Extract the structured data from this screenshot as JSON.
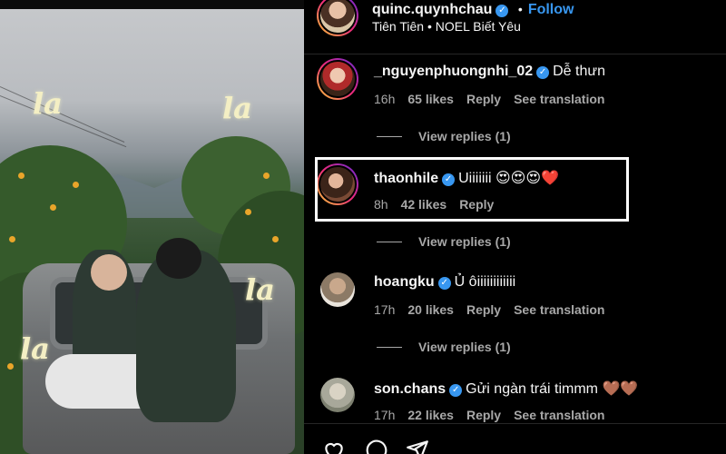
{
  "post": {
    "author": {
      "username": "quinc.quynhchau",
      "verified": true,
      "follow_label": "Follow",
      "separator": "•",
      "subtitle": "Tiên Tiên • NOEL Biết Yêu"
    },
    "photo": {
      "overlay_texts": [
        "la",
        "la",
        "la",
        "la"
      ]
    }
  },
  "comments": [
    {
      "username": "_nguyenphuongnhi_02",
      "verified": true,
      "text": "Dễ thưn",
      "time": "16h",
      "likes": "65 likes",
      "reply_label": "Reply",
      "translation_label": "See translation",
      "view_replies": "View replies (1)",
      "avatar_icon": "profile-photo"
    },
    {
      "username": "thaonhile",
      "verified": true,
      "text": "Uiiiiiii 😍😍😍❤️",
      "time": "8h",
      "likes": "42 likes",
      "reply_label": "Reply",
      "view_replies": "View replies (1)",
      "highlighted": true,
      "avatar_icon": "profile-photo"
    },
    {
      "username": "hoangku",
      "verified": true,
      "text": "Ủ ôiiiiiiiiiiii",
      "time": "17h",
      "likes": "20 likes",
      "reply_label": "Reply",
      "translation_label": "See translation",
      "view_replies": "View replies (1)",
      "avatar_icon": "profile-photo"
    },
    {
      "username": "son.chans",
      "verified": true,
      "text": "Gửi ngàn trái timmm 🤎🤎",
      "time": "17h",
      "likes": "22 likes",
      "reply_label": "Reply",
      "translation_label": "See translation",
      "avatar_icon": "profile-photo"
    }
  ],
  "actions": {
    "like_icon": "heart-icon",
    "comment_icon": "comment-icon",
    "share_icon": "share-icon"
  },
  "colors": {
    "accent": "#3897f0",
    "muted": "#a8a8a8",
    "background": "#000000",
    "highlight_border": "#ffffff"
  }
}
